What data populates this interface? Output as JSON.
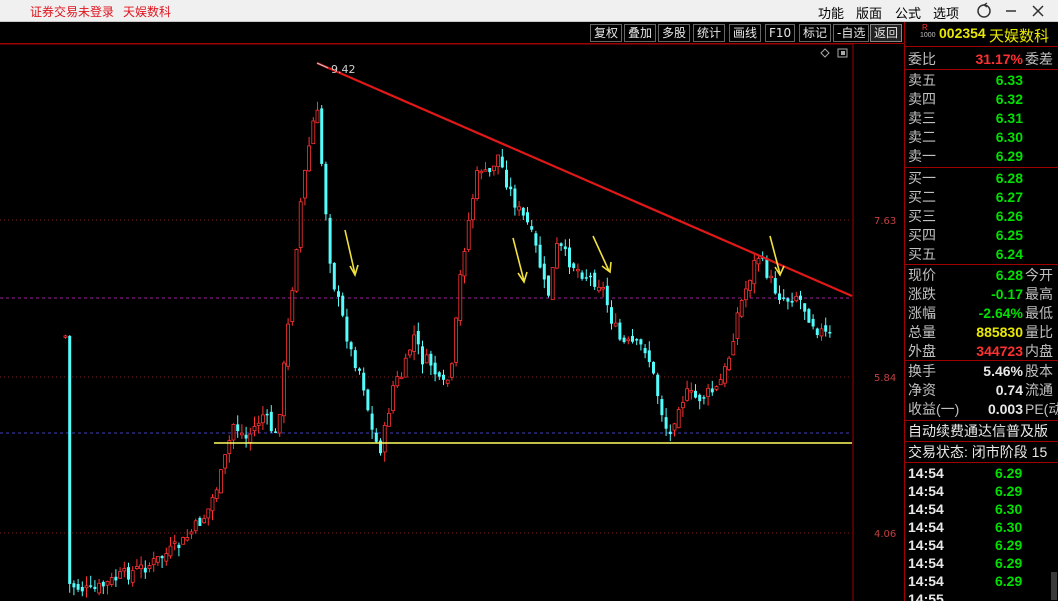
{
  "titlebar": {
    "warning": "证券交易未登录",
    "stock_name": "天娱数科",
    "menu": [
      "功能",
      "版面",
      "公式",
      "选项"
    ]
  },
  "toolbar": {
    "buttons": [
      "复权",
      "叠加",
      "多股",
      "统计",
      "画线",
      "F10",
      "标记",
      "-自选",
      "返回"
    ]
  },
  "chart": {
    "high_label": "9.42",
    "axis_labels": [
      "7.63",
      "5.84",
      "4.06"
    ],
    "colors": {
      "up": "#ff3232",
      "down": "#54fcfc",
      "trendline": "#e01818",
      "support": "#ffff60",
      "arrow": "#f0e040"
    }
  },
  "panel": {
    "badge": "R",
    "badge_sub": "1000",
    "code": "002354",
    "name": "天娱数科",
    "weibi_label": "委比",
    "weibi_value": "31.17%",
    "weicha_label": "委差",
    "asks": [
      {
        "label": "卖五",
        "price": "6.33"
      },
      {
        "label": "卖四",
        "price": "6.32"
      },
      {
        "label": "卖三",
        "price": "6.31"
      },
      {
        "label": "卖二",
        "price": "6.30"
      },
      {
        "label": "卖一",
        "price": "6.29"
      }
    ],
    "bids": [
      {
        "label": "买一",
        "price": "6.28"
      },
      {
        "label": "买二",
        "price": "6.27"
      },
      {
        "label": "买三",
        "price": "6.26"
      },
      {
        "label": "买四",
        "price": "6.25"
      },
      {
        "label": "买五",
        "price": "6.24"
      }
    ],
    "stats": [
      {
        "label": "现价",
        "value": "6.28",
        "tail": "今开",
        "color": "green"
      },
      {
        "label": "涨跌",
        "value": "-0.17",
        "tail": "最高",
        "color": "green"
      },
      {
        "label": "涨幅",
        "value": "-2.64%",
        "tail": "最低",
        "color": "green"
      },
      {
        "label": "总量",
        "value": "885830",
        "tail": "量比",
        "color": "yellow"
      },
      {
        "label": "外盘",
        "value": "344723",
        "tail": "内盘",
        "color": "red"
      }
    ],
    "stats2": [
      {
        "label": "换手",
        "value": "5.46%",
        "tail": "股本"
      },
      {
        "label": "净资",
        "value": "0.74",
        "tail": "流通"
      },
      {
        "label": "收益(一)",
        "value": "0.003",
        "tail": "PE(动"
      }
    ],
    "ticker_text": "自动续费通达信普及版",
    "status_text": "交易状态: 闭市阶段 15",
    "ticks": [
      {
        "time": "14:54",
        "price": "6.29"
      },
      {
        "time": "14:54",
        "price": "6.29"
      },
      {
        "time": "14:54",
        "price": "6.30"
      },
      {
        "time": "14:54",
        "price": "6.30"
      },
      {
        "time": "14:54",
        "price": "6.29"
      },
      {
        "time": "14:54",
        "price": "6.29"
      },
      {
        "time": "14:54",
        "price": "6.29"
      },
      {
        "time": "14:55",
        "price": ""
      }
    ]
  }
}
